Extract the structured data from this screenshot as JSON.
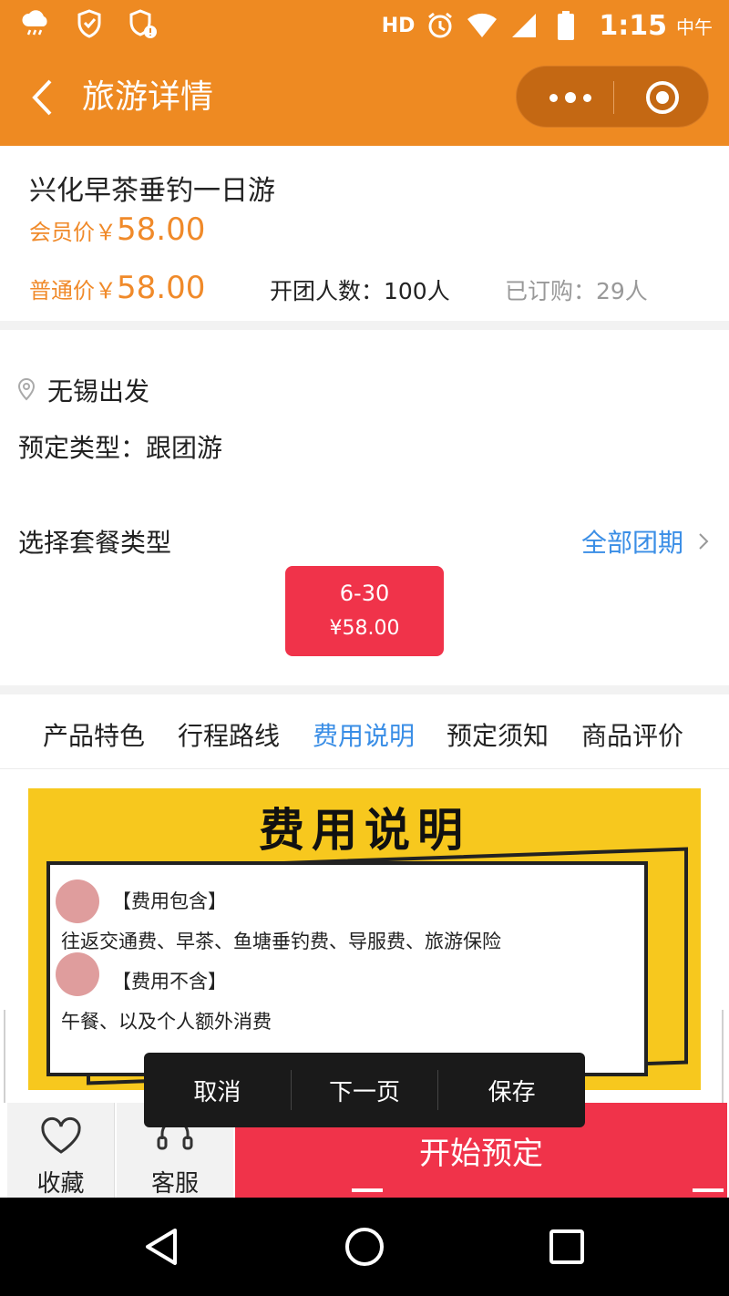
{
  "status_bar": {
    "icons": [
      "weather-rain-icon",
      "shield-check-icon",
      "shield-alert-icon",
      "alarm-icon",
      "wifi-icon",
      "signal-icon",
      "battery-icon"
    ],
    "hd": "HD",
    "time": "1:15",
    "period": "中午"
  },
  "nav": {
    "title": "旅游详情",
    "back_icon": "chevron-left-icon",
    "more_icon": "more-dots-icon",
    "close_icon": "target-icon"
  },
  "product": {
    "title": "兴化早茶垂钓一日游",
    "member_price_label": "会员价￥",
    "member_price": "58.00",
    "normal_price_label": "普通价￥",
    "normal_price": "58.00",
    "group_size": "开团人数：100人",
    "ordered": "已订购：29人"
  },
  "info": {
    "departure": "无锡出发",
    "booking_type": "预定类型：跟团游",
    "package_label": "选择套餐类型",
    "all_dates": "全部团期",
    "package": {
      "date": "6-30",
      "price": "¥58.00"
    }
  },
  "tabs": [
    {
      "label": "产品特色"
    },
    {
      "label": "行程路线"
    },
    {
      "label": "费用说明",
      "active": true
    },
    {
      "label": "预定须知"
    },
    {
      "label": "商品评价"
    }
  ],
  "fee_banner": {
    "heading": "费用说明",
    "included_title": "【费用包含】",
    "included_text": "往返交通费、早茶、鱼塘垂钓费、导服费、旅游保险",
    "excluded_title": "【费用不含】",
    "excluded_text": "午餐、以及个人额外消费"
  },
  "bottom_bar": {
    "favorite": "收藏",
    "service": "客服",
    "book": "开始预定"
  },
  "float_menu": {
    "cancel": "取消",
    "next": "下一页",
    "save": "保存"
  },
  "colors": {
    "brand_orange": "#ee8a22",
    "price_orange": "#f08a2a",
    "accent_blue": "#3a8ee6",
    "action_red": "#f0334a",
    "banner_yellow": "#f7c81e"
  }
}
